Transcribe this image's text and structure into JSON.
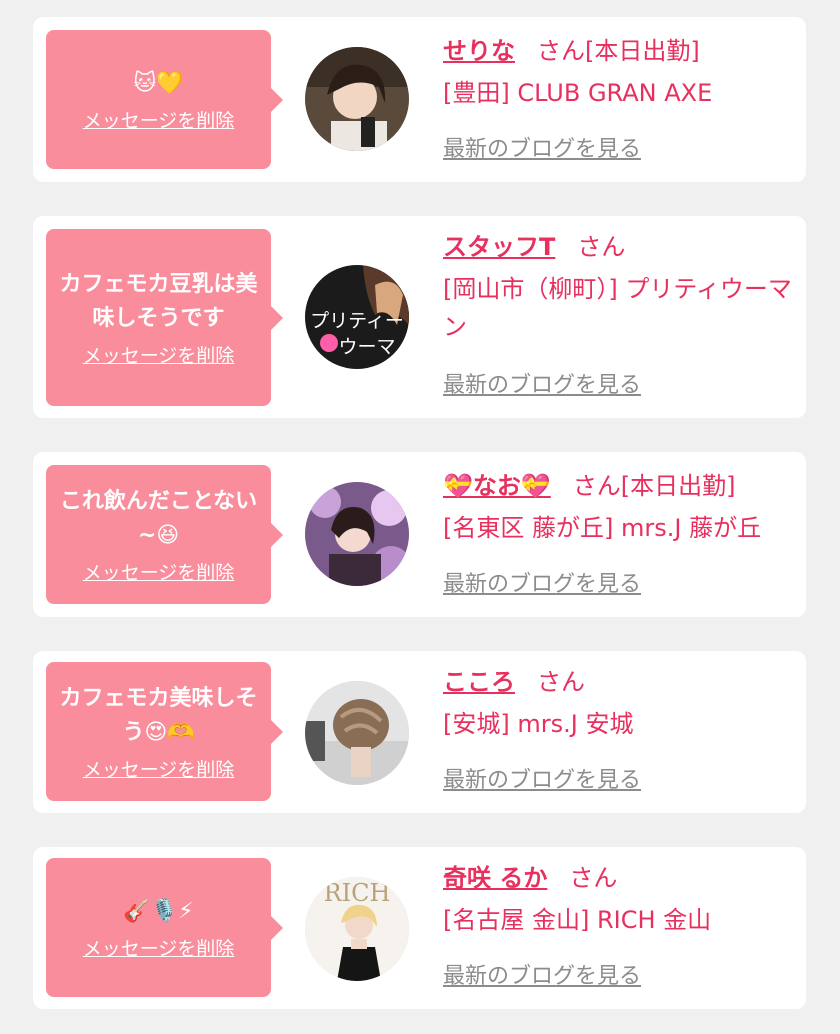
{
  "colors": {
    "page_bg": "#f0f0f0",
    "card_bg": "#ffffff",
    "bubble_bg": "#f98d9b",
    "accent": "#e8305e",
    "muted": "#8c8c8c"
  },
  "common": {
    "delete_label": "メッセージを削除",
    "san_label": "さん",
    "blog_label": "最新のブログを見る"
  },
  "items": [
    {
      "message": "🐱💛",
      "name": "せりな",
      "status": "[本日出勤]",
      "shop": "[豊田] CLUB GRAN AXE",
      "avatar_icon": "profile-photo"
    },
    {
      "message": "カフェモカ豆乳は美味しそうです",
      "name": "スタッフT",
      "status": "",
      "shop": "[岡山市（柳町）] プリティウーマン",
      "avatar_icon": "shop-logo",
      "avatar_text": "プリティーウーマ"
    },
    {
      "message": "これ飲んだことない~😆",
      "name": "💝なお💝",
      "status": "[本日出勤]",
      "shop": "[名東区 藤が丘] mrs.J 藤が丘",
      "avatar_icon": "profile-photo"
    },
    {
      "message": "カフェモカ美味しそう😍🫶",
      "name": "こころ",
      "status": "",
      "shop": "[安城] mrs.J 安城",
      "avatar_icon": "hairstyle-photo"
    },
    {
      "message": "🎸🎙️⚡",
      "name": "奇咲 るか",
      "status": "",
      "shop": "[名古屋 金山] RICH 金山",
      "avatar_icon": "magazine-cover",
      "avatar_text": "RICH"
    }
  ]
}
